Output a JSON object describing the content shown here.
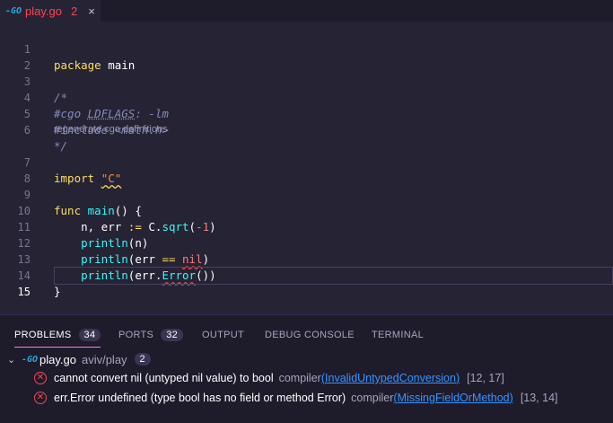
{
  "tab": {
    "filename": "play.go",
    "problem_count": "2",
    "close": "×",
    "go_icon": "-GO"
  },
  "editor": {
    "lines": [
      {
        "n": "1"
      },
      {
        "n": "2"
      },
      {
        "n": "3"
      },
      {
        "n": "4"
      },
      {
        "n": "5"
      },
      {
        "n": "6"
      },
      {
        "n": "7"
      },
      {
        "n": "8"
      },
      {
        "n": "9"
      },
      {
        "n": "10"
      },
      {
        "n": "11"
      },
      {
        "n": "12"
      },
      {
        "n": "13"
      },
      {
        "n": "14"
      },
      {
        "n": "15"
      }
    ],
    "code": {
      "l1_kw": "package",
      "l1_rest": " main",
      "l3": "/*",
      "l4a": "#cgo ",
      "l4b": "LDFLAGS",
      "l4c": ": -lm",
      "l5": "#include <math.h>",
      "l6": "*/",
      "lens": "regenerate cgo definitions",
      "l7_kw": "import",
      "l7_str": "\"C\"",
      "l9_kw": "func",
      "l9_fn": "main",
      "l9_rest": "() {",
      "l10a": "    n, err ",
      "l10op": ":=",
      "l10b": " C.",
      "l10fn": "sqrt",
      "l10c": "(",
      "l10num": "-1",
      "l10d": ")",
      "l11a": "    ",
      "l11fn": "println",
      "l11b": "(n)",
      "l12a": "    ",
      "l12fn": "println",
      "l12b": "(err ",
      "l12op": "==",
      "l12c": " ",
      "l12nil": "nil",
      "l12d": ")",
      "l13a": "    ",
      "l13fn": "println",
      "l13b": "(err.",
      "l13fn2": "Error",
      "l13c": "())",
      "l14": "}"
    }
  },
  "panel": {
    "tabs": [
      {
        "label": "PROBLEMS",
        "badge": "34"
      },
      {
        "label": "PORTS",
        "badge": "32"
      },
      {
        "label": "OUTPUT"
      },
      {
        "label": "DEBUG CONSOLE"
      },
      {
        "label": "TERMINAL"
      }
    ],
    "group": {
      "file": "play.go",
      "path": "aviv/play",
      "count": "2",
      "chevron": "⌄",
      "go_icon": "-GO"
    },
    "problems": [
      {
        "message": "cannot convert nil (untyped nil value) to bool",
        "source": "compiler",
        "code": "InvalidUntypedConversion",
        "position": "[12, 17]"
      },
      {
        "message": "err.Error undefined (type bool has no field or method Error)",
        "source": "compiler",
        "code": "MissingFieldOrMethod",
        "position": "[13, 14]"
      }
    ]
  },
  "colors": {
    "background": "#262335",
    "error": "#f14c4c",
    "keyword": "#fede5d",
    "function": "#36f9f6",
    "accent": "#ff7edb"
  }
}
